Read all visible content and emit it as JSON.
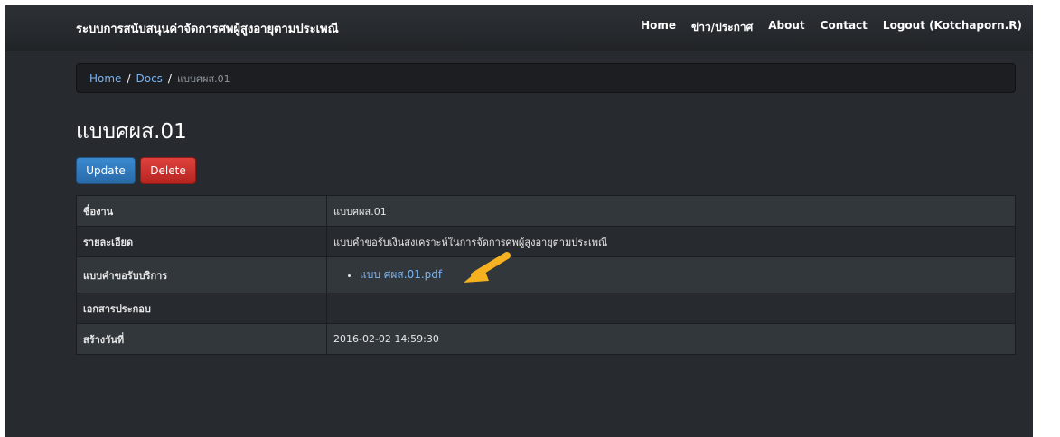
{
  "navbar": {
    "brand": "ระบบการสนับสนุนค่าจัดการศพผู้สูงอายุตามประเพณี",
    "items": [
      "Home",
      "ข่าว/ประกาศ",
      "About",
      "Contact",
      "Logout (Kotchaporn.R)"
    ]
  },
  "breadcrumb": {
    "home": "Home",
    "docs": "Docs",
    "separator": "/",
    "current": "แบบศผส.01"
  },
  "page": {
    "title": "แบบศผส.01",
    "update_label": "Update",
    "delete_label": "Delete"
  },
  "details": [
    {
      "label": "ชื่องาน",
      "value": "แบบศผส.01"
    },
    {
      "label": "รายละเอียด",
      "value": "แบบคำขอรับเงินสงเคราะห์ในการจัดการศพผู้สูงอายุตามประเพณี"
    },
    {
      "label": "แบบคำขอรับบริการ",
      "file": "แบบ ศผส.01.pdf"
    },
    {
      "label": "เอกสารประกอบ",
      "value": ""
    },
    {
      "label": "สร้างวันที่",
      "value": "2016-02-02 14:59:30"
    }
  ],
  "colors": {
    "background": "#272b30",
    "link": "#7ab3f0",
    "update_button": "#2a6aa8",
    "delete_button": "#c9302c",
    "arrow": "#f5b120"
  },
  "icons": {
    "annotation": "arrow-pointer-icon",
    "bullet": "bullet-icon"
  }
}
